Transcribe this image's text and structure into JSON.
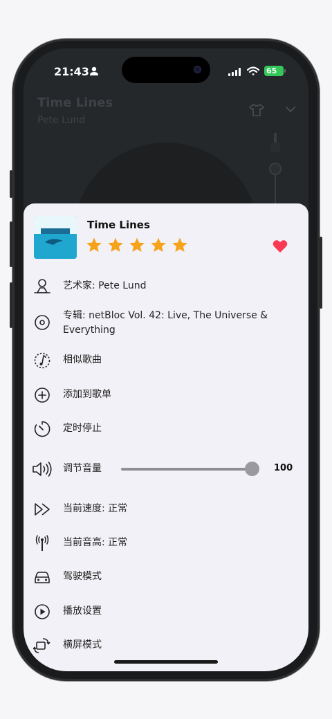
{
  "status_bar": {
    "time": "21:43",
    "battery": "65"
  },
  "background_player": {
    "title": "Time Lines",
    "artist": "Pete Lund"
  },
  "sheet": {
    "song_title": "Time Lines",
    "rating_stars": 5,
    "favorited": true,
    "menu": [
      {
        "label": "艺术家: Pete Lund",
        "icon": "artist-icon"
      },
      {
        "label": "专辑: netBloc Vol. 42: Live, The Universe & Everything",
        "icon": "album-icon"
      },
      {
        "label": "相似歌曲",
        "icon": "similar-songs-icon"
      },
      {
        "label": "添加到歌单",
        "icon": "add-to-playlist-icon"
      },
      {
        "label": "定时停止",
        "icon": "timer-icon"
      },
      {
        "label": "调节音量",
        "icon": "volume-icon"
      },
      {
        "label": "当前速度: 正常",
        "icon": "speed-icon"
      },
      {
        "label": "当前音高: 正常",
        "icon": "pitch-icon"
      },
      {
        "label": "驾驶模式",
        "icon": "car-icon"
      },
      {
        "label": "播放设置",
        "icon": "play-settings-icon"
      },
      {
        "label": "横屏模式",
        "icon": "rotate-icon"
      }
    ],
    "volume_value": "100",
    "volume_level": 1.0
  },
  "colors": {
    "star": "#f7a21b",
    "heart": "#fa3a55",
    "battery": "#34c759"
  }
}
